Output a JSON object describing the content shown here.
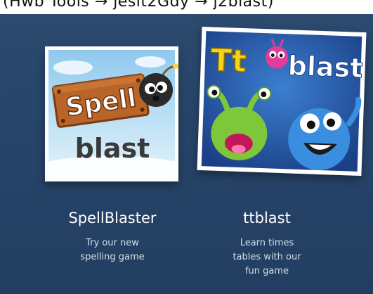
{
  "breadcrumb": {
    "text": "(Hwb Tools → jesit2Gdy → j2blast)"
  },
  "games": [
    {
      "title": "SpellBlaster",
      "description": [
        "Try our new",
        "spelling game"
      ],
      "logo_text_1": "Spell",
      "logo_text_2": "blast"
    },
    {
      "title": "ttblast",
      "description": [
        "Learn times",
        "tables with our",
        "fun game"
      ],
      "logo_text_1": "Tt",
      "logo_text_2": "blast"
    }
  ],
  "colors": {
    "background": "#27456a",
    "title": "#ffffff",
    "description": "#d4deea",
    "wood": "#b9652a",
    "tt_green": "#7ec63a",
    "tt_blue": "#3a8ee0"
  }
}
